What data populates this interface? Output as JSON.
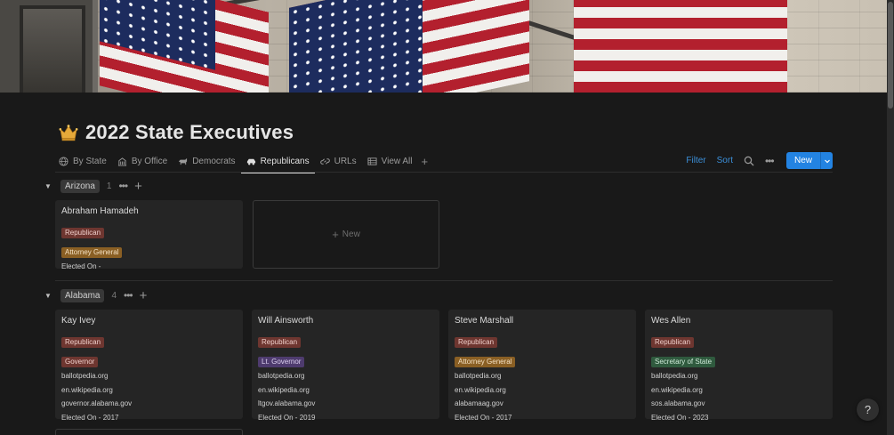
{
  "page": {
    "title": "2022 State Executives",
    "icon": "crown-icon"
  },
  "tabs": [
    {
      "label": "By State",
      "icon": "globe-icon",
      "active": false
    },
    {
      "label": "By Office",
      "icon": "building-icon",
      "active": false
    },
    {
      "label": "Democrats",
      "icon": "donkey-icon",
      "active": false
    },
    {
      "label": "Republicans",
      "icon": "car-icon",
      "active": true
    },
    {
      "label": "URLs",
      "icon": "link-icon",
      "active": false
    },
    {
      "label": "View All",
      "icon": "table-icon",
      "active": false
    }
  ],
  "toolbar": {
    "filter": "Filter",
    "sort": "Sort",
    "new": "New"
  },
  "groups": [
    {
      "name": "Arizona",
      "count": "1",
      "cards": [
        {
          "name": "Abraham Hamadeh",
          "party": "Republican",
          "office": "Attorney General",
          "elected": "Elected On -"
        }
      ],
      "new_label": "New"
    },
    {
      "name": "Alabama",
      "count": "4",
      "cards": [
        {
          "name": "Kay Ivey",
          "party": "Republican",
          "office": "Governor",
          "url1": "ballotpedia.org",
          "url2": "en.wikipedia.org",
          "url3": "governor.alabama.gov",
          "elected": "Elected On - 2017"
        },
        {
          "name": "Will Ainsworth",
          "party": "Republican",
          "office": "Lt. Governor",
          "url1": "ballotpedia.org",
          "url2": "en.wikipedia.org",
          "url3": "ltgov.alabama.gov",
          "elected": "Elected On - 2019"
        },
        {
          "name": "Steve Marshall",
          "party": "Republican",
          "office": "Attorney General",
          "url1": "ballotpedia.org",
          "url2": "en.wikipedia.org",
          "url3": "alabamaag.gov",
          "elected": "Elected On - 2017"
        },
        {
          "name": "Wes Allen",
          "party": "Republican",
          "office": "Secretary of State",
          "url1": "ballotpedia.org",
          "url2": "en.wikipedia.org",
          "url3": "sos.alabama.gov",
          "elected": "Elected On - 2023"
        }
      ]
    }
  ],
  "help": "?",
  "colors": {
    "accent": "#2383e2",
    "republican_tag": "#6e3630",
    "attorney_general_tag": "#8a5f24",
    "lt_governor_tag": "#4e3b6e",
    "secretary_of_state_tag": "#2f5a3e"
  }
}
